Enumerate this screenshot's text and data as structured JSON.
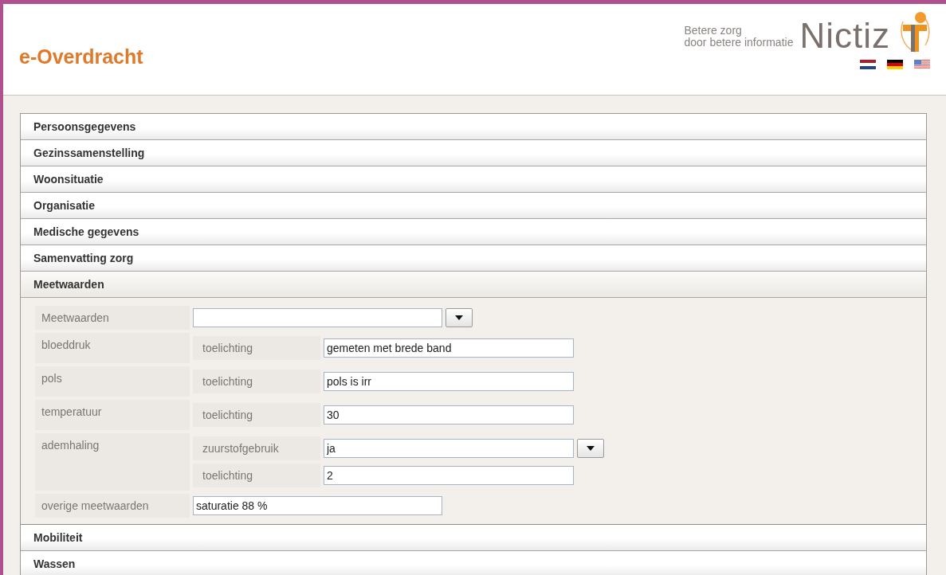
{
  "header": {
    "title": "e-Overdracht",
    "tagline": [
      "Betere zorg",
      "door betere informatie"
    ],
    "logo_text": "Nictiz"
  },
  "sections": [
    {
      "title": "Persoonsgegevens",
      "expanded": false
    },
    {
      "title": "Gezinssamenstelling",
      "expanded": false
    },
    {
      "title": "Woonsituatie",
      "expanded": false
    },
    {
      "title": "Organisatie",
      "expanded": false
    },
    {
      "title": "Medische gegevens",
      "expanded": false
    },
    {
      "title": "Samenvatting zorg",
      "expanded": false
    },
    {
      "title": "Meetwaarden",
      "expanded": true,
      "rows": [
        {
          "kind": "select",
          "label": "Meetwaarden"
        },
        {
          "kind": "group",
          "label": "bloeddruk",
          "items": [
            {
              "kind": "text",
              "label": "toelichting",
              "value": "gemeten met brede band"
            }
          ]
        },
        {
          "kind": "group",
          "label": "pols",
          "items": [
            {
              "kind": "text",
              "label": "toelichting",
              "value": "pols is irr"
            }
          ]
        },
        {
          "kind": "group",
          "label": "temperatuur",
          "items": [
            {
              "kind": "text",
              "label": "toelichting",
              "value": "30"
            }
          ]
        },
        {
          "kind": "group",
          "label": "ademhaling",
          "items": [
            {
              "kind": "select",
              "label": "zuurstofgebruik",
              "value": "ja"
            },
            {
              "kind": "text",
              "label": "toelichting",
              "value": "2"
            }
          ]
        },
        {
          "kind": "text",
          "label": "overige meetwaarden",
          "value": "saturatie 88 %"
        }
      ]
    },
    {
      "title": "Mobiliteit",
      "expanded": false
    },
    {
      "title": "Wassen",
      "expanded": false
    }
  ]
}
